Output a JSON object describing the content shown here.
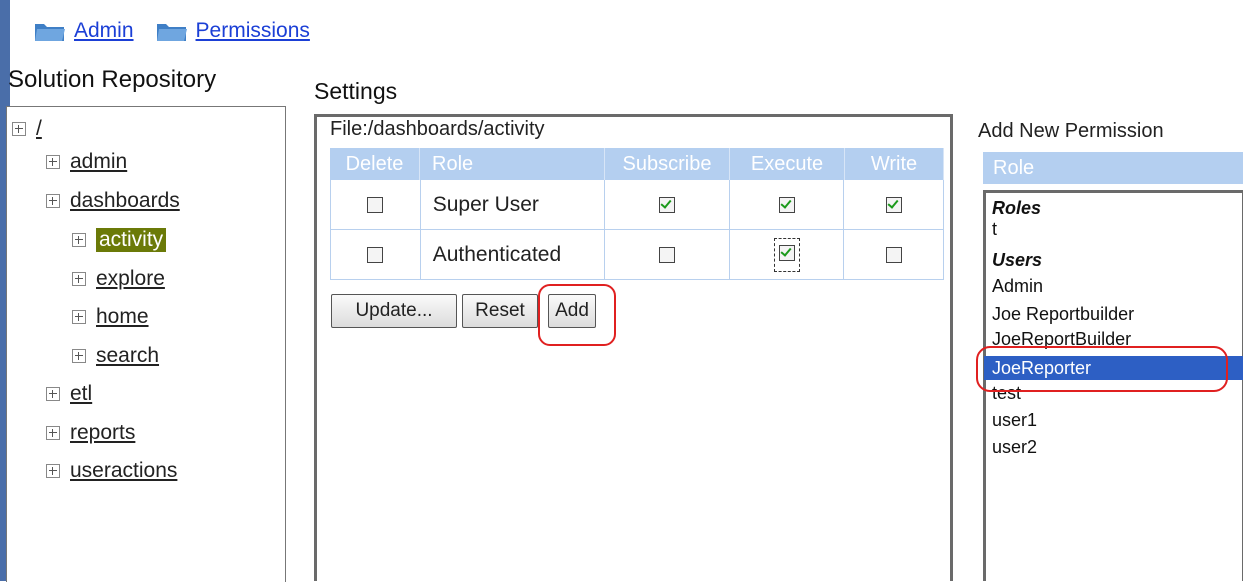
{
  "breadcrumb": [
    {
      "label": "Admin",
      "icon": "folder-icon"
    },
    {
      "label": "Permissions",
      "icon": "folder-icon"
    }
  ],
  "repository": {
    "title": "Solution Repository",
    "tree": [
      {
        "label": "/",
        "level": 0,
        "selected": false
      },
      {
        "label": "admin",
        "level": 1,
        "selected": false
      },
      {
        "label": "dashboards",
        "level": 1,
        "selected": false
      },
      {
        "label": "activity",
        "level": 2,
        "selected": true
      },
      {
        "label": "explore",
        "level": 2,
        "selected": false
      },
      {
        "label": "home",
        "level": 2,
        "selected": false
      },
      {
        "label": "search",
        "level": 2,
        "selected": false
      },
      {
        "label": "etl",
        "level": 1,
        "selected": false
      },
      {
        "label": "reports",
        "level": 1,
        "selected": false
      },
      {
        "label": "useractions",
        "level": 1,
        "selected": false
      }
    ]
  },
  "settings": {
    "title": "Settings",
    "file_label": "File:/dashboards/activity",
    "columns": [
      "Delete",
      "Role",
      "Subscribe",
      "Execute",
      "Write"
    ],
    "rows": [
      {
        "delete": false,
        "role": "Super User",
        "subscribe": true,
        "execute": true,
        "write": true
      },
      {
        "delete": false,
        "role": "Authenticated",
        "subscribe": false,
        "execute": true,
        "write": false
      }
    ],
    "buttons": {
      "update": "Update...",
      "reset": "Reset",
      "add": "Add"
    }
  },
  "add_permission": {
    "title": "Add New Permission",
    "column": "Role",
    "items": [
      {
        "label": "Roles",
        "group": true,
        "selected": false
      },
      {
        "label": "t",
        "group": false,
        "selected": false
      },
      {
        "label": "Users",
        "group": true,
        "selected": false
      },
      {
        "label": "Admin",
        "group": false,
        "selected": false
      },
      {
        "label": "Joe Reportbuilder",
        "group": false,
        "selected": false
      },
      {
        "label": "JoeReportBuilder",
        "group": false,
        "selected": false
      },
      {
        "label": "JoeReporter",
        "group": false,
        "selected": true
      },
      {
        "label": "test",
        "group": false,
        "selected": false
      },
      {
        "label": "user1",
        "group": false,
        "selected": false
      },
      {
        "label": "user2",
        "group": false,
        "selected": false
      }
    ]
  },
  "colors": {
    "header_blue": "#b4cff0",
    "selection_blue": "#2d5fc4",
    "tree_selected": "#6b7a08",
    "annotation_red": "#e02020",
    "link_blue": "#1b3fd6"
  }
}
